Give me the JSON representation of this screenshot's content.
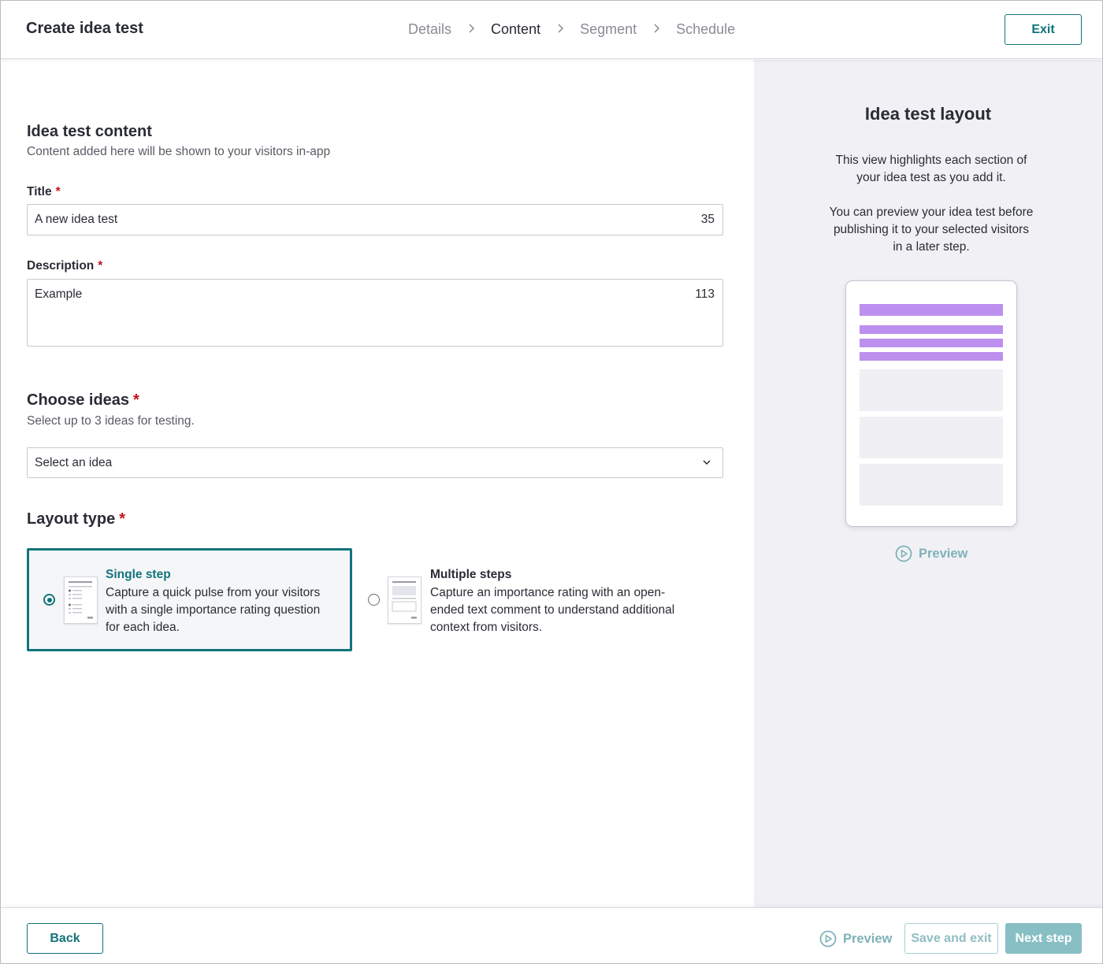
{
  "header": {
    "title": "Create idea test",
    "steps": [
      "Details",
      "Content",
      "Segment",
      "Schedule"
    ],
    "active_step": "Content",
    "exit_label": "Exit"
  },
  "content": {
    "section_title": "Idea test content",
    "section_subtitle": "Content added here will be shown to your visitors in-app",
    "title_label": "Title",
    "title_value": "A new idea test",
    "title_count": "35",
    "description_label": "Description",
    "description_value": "Example",
    "description_count": "113",
    "required_marker": "*"
  },
  "ideas": {
    "title": "Choose ideas",
    "subtitle": "Select up to 3 ideas for testing.",
    "select_value": "Select an idea"
  },
  "layout": {
    "title": "Layout type",
    "options": [
      {
        "title": "Single step",
        "description_lines": [
          "Capture a quick pulse from your visitors",
          "with a single importance rating question",
          "for each idea."
        ],
        "selected": true
      },
      {
        "title": "Multiple steps",
        "description_lines": [
          "Capture an importance rating with an open-",
          "ended text comment to understand additional",
          "context from visitors."
        ],
        "selected": false
      }
    ]
  },
  "side": {
    "title": "Idea test layout",
    "text1_lines": [
      "This view highlights each section of",
      "your idea test as you add it."
    ],
    "text2_lines": [
      "You can preview your idea test before",
      "publishing it to your selected visitors",
      "in a later step."
    ],
    "preview_label": "Preview",
    "highlight_color": "#bd90ef"
  },
  "footer": {
    "back_label": "Back",
    "preview_label": "Preview",
    "save_label": "Save and exit",
    "next_label": "Next step"
  },
  "colors": {
    "accent": "#12737b",
    "required": "#c4141a",
    "disabled_accent": "#88bfc5"
  }
}
